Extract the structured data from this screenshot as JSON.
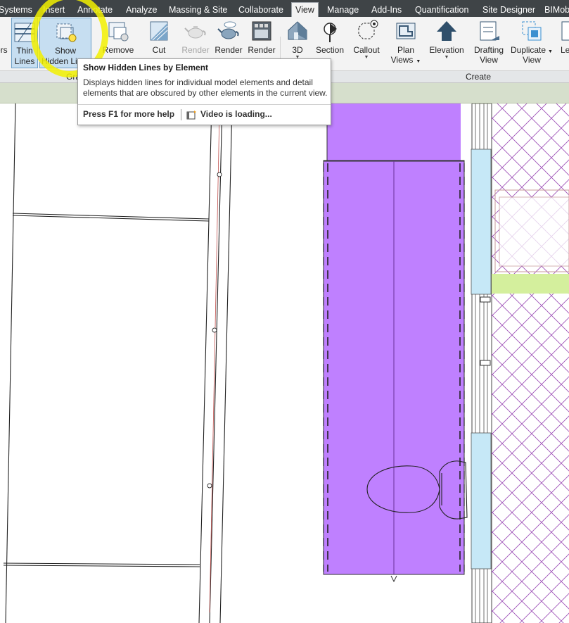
{
  "tabs": [
    {
      "label": "Systems",
      "active": false
    },
    {
      "label": "Insert",
      "active": false
    },
    {
      "label": "Annotate",
      "active": false
    },
    {
      "label": "Analyze",
      "active": false
    },
    {
      "label": "Massing & Site",
      "active": false
    },
    {
      "label": "Collaborate",
      "active": false
    },
    {
      "label": "View",
      "active": true
    },
    {
      "label": "Manage",
      "active": false
    },
    {
      "label": "Add-Ins",
      "active": false
    },
    {
      "label": "Quantification",
      "active": false
    },
    {
      "label": "Site Designer",
      "active": false
    },
    {
      "label": "BIMob",
      "active": false
    }
  ],
  "ribbon": {
    "buttons": [
      {
        "id": "layers",
        "line1": "ers",
        "line2": "",
        "icon": "layers-icon",
        "disabled": false
      },
      {
        "id": "thin",
        "line1": "Thin",
        "line2": "Lines",
        "icon": "thin-lines-icon",
        "disabled": false
      },
      {
        "id": "show",
        "line1": "Show",
        "line2": "Hidden Li",
        "icon": "show-hidden-lines-icon",
        "disabled": false
      },
      {
        "id": "remove",
        "line1": "Remove",
        "line2": "",
        "icon": "remove-hidden-lines-icon",
        "disabled": false
      },
      {
        "id": "cut",
        "line1": "Cut",
        "line2": "",
        "icon": "cut-profile-icon",
        "disabled": false
      },
      {
        "id": "render",
        "line1": "Render",
        "line2": "",
        "icon": "render-teapot-icon",
        "disabled": true
      },
      {
        "id": "render2",
        "line1": "Render",
        "line2": "",
        "icon": "render-cloud-teapot-icon",
        "disabled": false
      },
      {
        "id": "render3",
        "line1": "Render",
        "line2": "",
        "icon": "render-gallery-icon",
        "disabled": false
      },
      {
        "id": "view3d",
        "line1": "3D",
        "line2": "",
        "icon": "3d-view-house-icon",
        "disabled": false
      },
      {
        "id": "section",
        "line1": "Section",
        "line2": "",
        "icon": "section-icon",
        "disabled": false
      },
      {
        "id": "callout",
        "line1": "Callout",
        "line2": "",
        "icon": "callout-icon",
        "disabled": false
      },
      {
        "id": "plan",
        "line1": "Plan",
        "line2": "Views",
        "icon": "plan-views-icon",
        "disabled": false
      },
      {
        "id": "elevation",
        "line1": "Elevation",
        "line2": "",
        "icon": "elevation-icon",
        "disabled": false
      },
      {
        "id": "drafting",
        "line1": "Drafting",
        "line2": "View",
        "icon": "drafting-view-icon",
        "disabled": false
      },
      {
        "id": "duplicate",
        "line1": "Duplicate",
        "line2": "View",
        "icon": "duplicate-view-icon",
        "disabled": false
      },
      {
        "id": "legend",
        "line1": "Le",
        "line2": "",
        "icon": "legend-icon",
        "disabled": false
      }
    ],
    "panels": {
      "graphics_partial": "Gra",
      "create": "Create"
    }
  },
  "tooltip": {
    "title": "Show Hidden Lines by Element",
    "description": "Displays hidden lines for individual model elements and detail elements that are obscured by other elements in the current view.",
    "help": "Press F1 for more help",
    "video": "Video is loading..."
  },
  "colors": {
    "menubar": "#3f4447",
    "ribbon": "#f3f3f3",
    "room_fill": "#bf80ff",
    "glass": "#c6e8f7",
    "wall_band": "#d4ef9d",
    "hatch": "#9a4bb5",
    "highlight": "#f2f000"
  }
}
